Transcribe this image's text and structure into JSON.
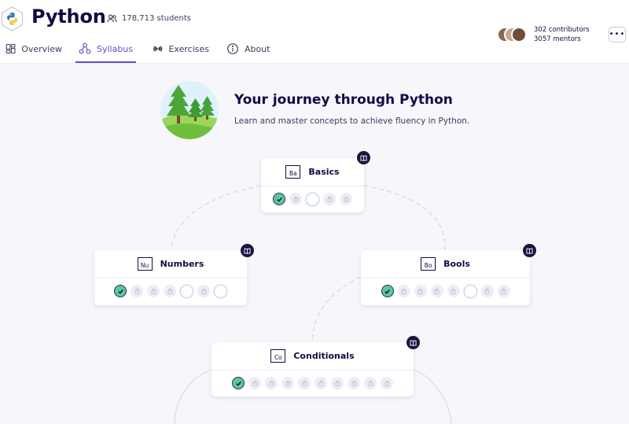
{
  "header": {
    "track_title": "Python",
    "students": "178,713 students",
    "contributors": "302 contributors",
    "mentors": "3057 mentors",
    "more_label": "•••"
  },
  "tabs": [
    {
      "label": "Overview",
      "icon": "overview-icon",
      "active": false
    },
    {
      "label": "Syllabus",
      "icon": "syllabus-icon",
      "active": true
    },
    {
      "label": "Exercises",
      "icon": "dumbbell-icon",
      "active": false
    },
    {
      "label": "About",
      "icon": "info-icon",
      "active": false
    }
  ],
  "intro": {
    "title": "Your journey through Python",
    "subtitle": "Learn and master concepts to achieve fluency in Python."
  },
  "concepts": [
    {
      "symbol": "Ba",
      "name": "Basics",
      "exercises": [
        "done",
        "locked",
        "available",
        "locked",
        "locked"
      ]
    },
    {
      "symbol": "Nu",
      "name": "Numbers",
      "exercises": [
        "done",
        "locked",
        "locked",
        "locked",
        "available",
        "locked",
        "available"
      ]
    },
    {
      "symbol": "Bo",
      "name": "Bools",
      "exercises": [
        "done",
        "locked",
        "locked",
        "locked",
        "locked",
        "available",
        "locked",
        "locked"
      ]
    },
    {
      "symbol": "Co",
      "name": "Conditionals",
      "exercises": [
        "done",
        "locked",
        "locked",
        "locked",
        "locked",
        "locked",
        "locked",
        "locked",
        "locked",
        "locked"
      ]
    }
  ],
  "colors": {
    "accent": "#604fcd",
    "done": "#5ac7a0",
    "text": "#130b43",
    "background": "#f6f6fb"
  }
}
